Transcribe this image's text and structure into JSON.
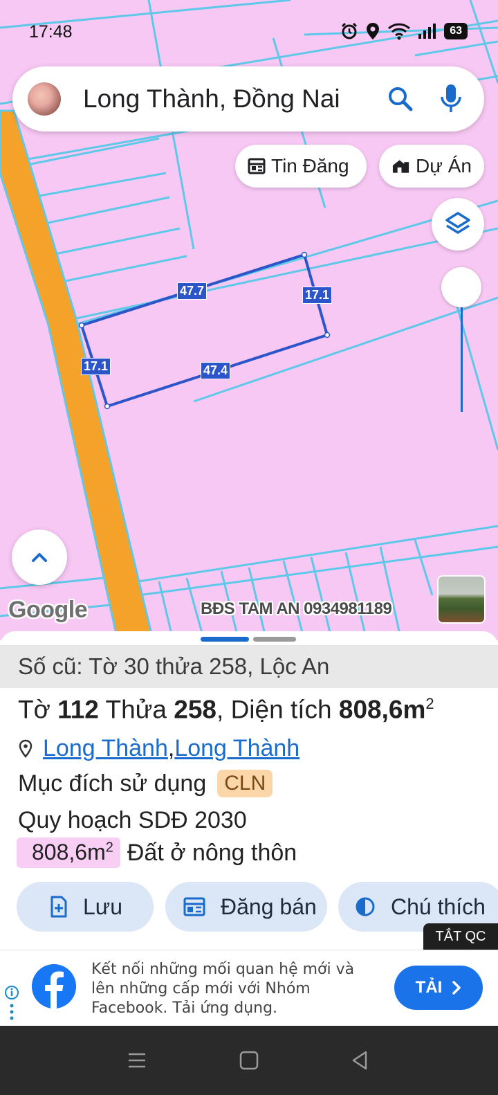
{
  "status_bar": {
    "time": "17:48",
    "battery": "63"
  },
  "search": {
    "query": "Long Thành, Đồng Nai"
  },
  "chips": {
    "listings": "Tin Đăng",
    "projects": "Dự Án"
  },
  "map": {
    "edge_labels": [
      "47.7",
      "17.1",
      "17.1",
      "47.4"
    ],
    "google": "Google",
    "watermark": "BĐS TAM AN 0934981189"
  },
  "parcel": {
    "old_number": "Số cũ: Tờ 30 thửa 258, Lộc An",
    "sheet_prefix": "Tờ ",
    "sheet": "112",
    "plot_prefix": " Thửa ",
    "plot": "258",
    "area_prefix": ", Diện tích ",
    "area": "808,6m",
    "area_sup": "2",
    "location_1": "Long Thành",
    "location_sep": ", ",
    "location_2": "Long Thành",
    "use_label": "Mục đích sử dụng",
    "use_code": "CLN",
    "plan_label": "Quy hoạch SDĐ 2030",
    "plan_area": "808,6m",
    "plan_area_sup": "2",
    "plan_type": "Đất ở nông thôn"
  },
  "actions": {
    "save": "Lưu",
    "sell": "Đăng bán",
    "legend": "Chú thích"
  },
  "ad": {
    "close_label": "TẮT QC",
    "text": "Kết nối những mối quan hệ mới và lên những cấp mới với Nhóm Facebook. Tải ứng dụng.",
    "cta": "TẢI"
  },
  "colors": {
    "map_land": "#f8c8f4",
    "road": "#f5a22a",
    "parcel_line": "#2b55c8",
    "accent": "#1a73e8"
  }
}
